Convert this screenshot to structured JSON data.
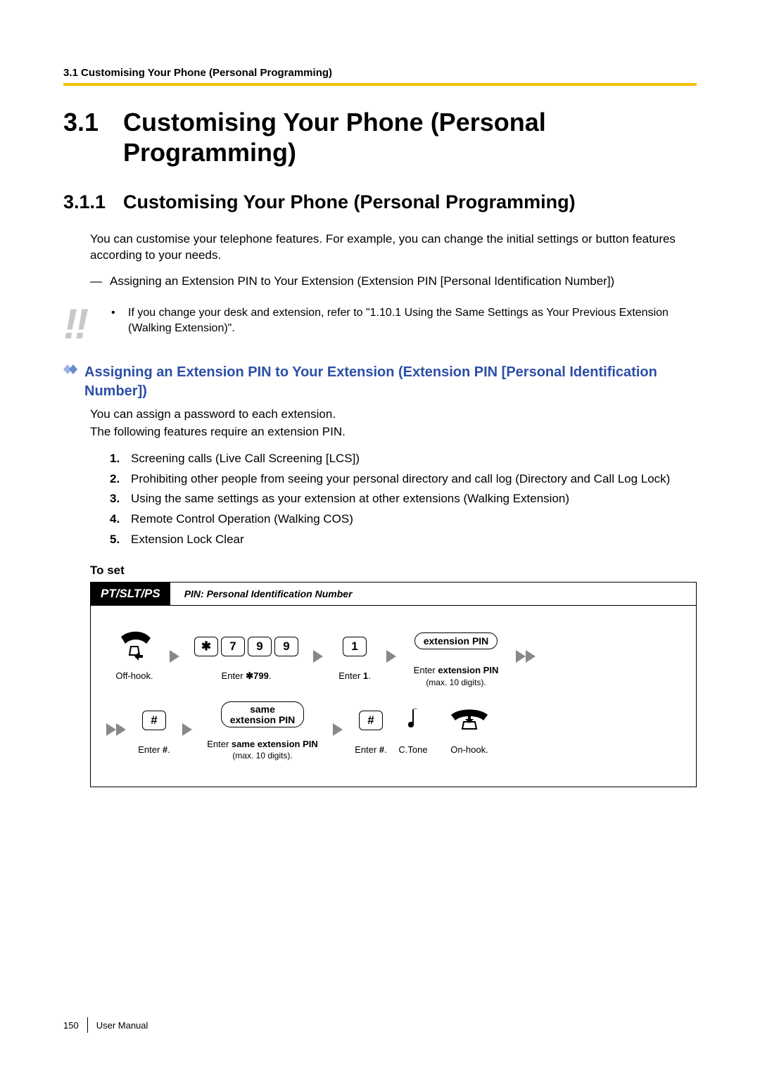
{
  "running_head": "3.1 Customising Your Phone (Personal Programming)",
  "h1": {
    "num": "3.1",
    "txt": "Customising Your Phone (Personal Programming)"
  },
  "h2": {
    "num": "3.1.1",
    "txt": "Customising Your Phone (Personal Programming)"
  },
  "intro": "You can customise your telephone features. For example, you can change the initial settings or button features according to your needs.",
  "emdash": "Assigning an Extension PIN to Your Extension (Extension PIN [Personal Identification Number])",
  "note_icon": "!!",
  "note": "If you change your desk and extension, refer to \"1.10.1 Using the Same Settings as Your Previous Extension (Walking Extension)\".",
  "blue_heading": "Assigning an Extension PIN to Your Extension (Extension PIN [Personal Identification Number])",
  "pin_p1": "You can assign a password to each extension.",
  "pin_p2": "The following features require an extension PIN.",
  "ol": [
    "Screening calls (Live Call Screening [LCS])",
    "Prohibiting other people from seeing your personal directory and call log (Directory and Call Log Lock)",
    "Using the same settings as your extension at other extensions (Walking Extension)",
    "Remote Control Operation (Walking COS)",
    "Extension Lock Clear"
  ],
  "to_set": "To set",
  "proc": {
    "device": "PT/SLT/PS",
    "legend": "PIN: Personal Identification Number",
    "keys": {
      "star": "✱",
      "d1": "7",
      "d2": "9",
      "d3": "9",
      "one": "1",
      "hash": "#"
    },
    "captions": {
      "offhook": "Off-hook.",
      "enter799_pre": "Enter ",
      "enter799_code": "✱799",
      "enter799_post": ".",
      "enter1_pre": "Enter ",
      "enter1_b": "1",
      "enter1_post": ".",
      "extpin_label": "extension PIN",
      "extpin_pre": "Enter ",
      "extpin_b": "extension PIN",
      "extpin_post": "\n(max. 10 digits).",
      "hash_pre": "Enter ",
      "hash_b": "#",
      "hash_post": ".",
      "same_label_1": "same",
      "same_label_2": "extension PIN",
      "same_pre": "Enter ",
      "same_b": "same extension PIN",
      "same_post": "\n(max. 10 digits).",
      "ctone": "C.Tone",
      "onhook": "On-hook."
    }
  },
  "footer": {
    "page": "150",
    "doc": "User Manual"
  }
}
